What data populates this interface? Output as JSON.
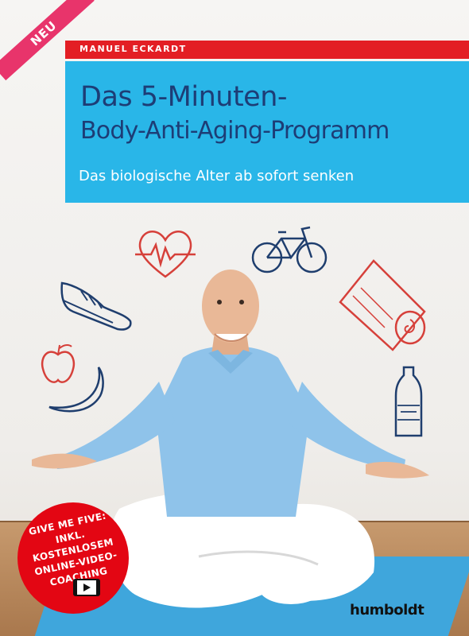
{
  "badge": {
    "label": "NEU"
  },
  "author": "MANUEL ECKARDT",
  "title": {
    "line1": "Das 5-Minuten-",
    "line2": "Body-Anti-Aging-Programm"
  },
  "subtitle": "Das biologische Alter ab sofort senken",
  "icons": [
    "heart-rate-icon",
    "bicycle-icon",
    "sneaker-icon",
    "yoga-mat-roll-icon",
    "apple-icon",
    "banana-icon",
    "water-bottle-icon",
    "video-play-icon"
  ],
  "sticker": {
    "line1": "GIVE ME FIVE:",
    "line2": "INKL. KOSTENLOSEM",
    "line3": "ONLINE-VIDEO-",
    "line4": "COACHING"
  },
  "publisher": "humboldt",
  "colors": {
    "title_panel": "#29b6e8",
    "title_text": "#1d3d76",
    "author_bar": "#e31e24",
    "badge": "#e8346b",
    "sticker": "#e30613",
    "mat": "#3fa6dc",
    "doodles_red": "#d6403a",
    "doodles_navy": "#1f3e6e"
  }
}
